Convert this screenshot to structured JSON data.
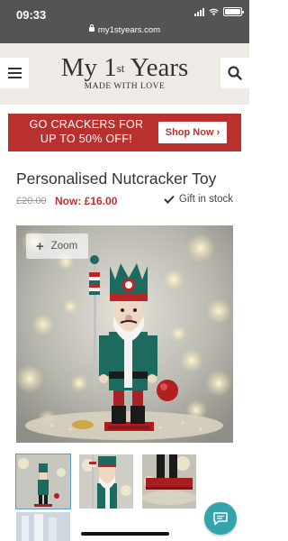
{
  "status_bar": {
    "time": "09:33",
    "url": "my1styears.com",
    "icons": [
      "signal-icon",
      "wifi-icon",
      "battery-icon"
    ]
  },
  "header": {
    "logo_main": "My 1",
    "logo_sup": "st",
    "logo_end": " Years",
    "logo_tagline": "MADE WITH LOVE",
    "menu_icon": "hamburger-menu-icon",
    "search_icon": "search-icon",
    "background_color": "#eeebe7"
  },
  "promo_banner": {
    "line1": "GO CRACKERS FOR",
    "line2": "UP TO 50% OFF!",
    "button_label": "Shop Now",
    "button_arrow": "›",
    "background_color": "#b8312f"
  },
  "product": {
    "title": "Personalised Nutcracker Toy",
    "old_price": "£20.00",
    "now_price": "Now: £16.00",
    "stock_label": "Gift in stock",
    "stock_icon": "checkmark-icon",
    "price_color": "#b8312f"
  },
  "gallery": {
    "zoom_label": "Zoom",
    "zoom_icon": "plus-icon",
    "thumbnails": [
      "nutcracker-full",
      "nutcracker-closeup",
      "nutcracker-base",
      "nutcracker-blue"
    ]
  },
  "chat": {
    "icon": "chat-bubble-icon",
    "color": "#33a3ad"
  }
}
